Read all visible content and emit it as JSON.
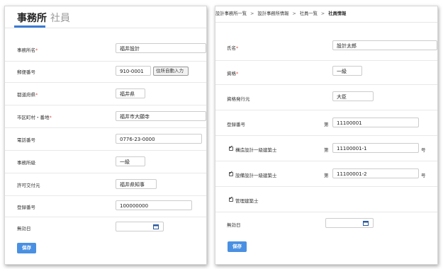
{
  "left": {
    "tabs": [
      "事務所",
      "社員"
    ],
    "fields": [
      {
        "label": "事務所名",
        "required": true,
        "value": "福井設計"
      },
      {
        "label": "郵便番号",
        "required": false,
        "value": "910-0001",
        "button": "住所自動入力"
      },
      {
        "label": "都道府県",
        "required": true,
        "value": "福井県"
      },
      {
        "label": "市区町村・番地",
        "required": true,
        "value": "福井市大願寺"
      },
      {
        "label": "電話番号",
        "required": false,
        "value": "0776-23-0000"
      },
      {
        "label": "事務所級",
        "required": false,
        "value": "一級"
      },
      {
        "label": "許可交付元",
        "required": false,
        "value": "福井県知事"
      },
      {
        "label": "登録番号",
        "required": false,
        "value": "100000000"
      },
      {
        "label": "無効日",
        "required": false,
        "value": ""
      }
    ],
    "save_label": "保存"
  },
  "right": {
    "breadcrumb": [
      "設計事務所一覧",
      "設計事務所情報",
      "社員一覧",
      "社員情報"
    ],
    "fields": [
      {
        "label": "氏名",
        "required": true,
        "value": "設計太郎"
      },
      {
        "label": "資格",
        "required": true,
        "value": "一級"
      },
      {
        "label": "資格発行元",
        "required": false,
        "value": "大臣"
      },
      {
        "label": "登録番号",
        "required": false,
        "prefix": "第",
        "value": "11100001"
      },
      {
        "label": "構造設計一級建築士",
        "checked": true,
        "prefix": "第",
        "value": "11100001-1",
        "suffix": "号"
      },
      {
        "label": "設備設計一級建築士",
        "checked": true,
        "prefix": "第",
        "value": "11100001-2",
        "suffix": "号"
      },
      {
        "label": "管理建築士",
        "checked": true
      },
      {
        "label": "無効日",
        "required": false,
        "value": ""
      }
    ],
    "save_label": "保存"
  },
  "colors": {
    "accent": "#4a90e2",
    "required": "#d9534f"
  }
}
